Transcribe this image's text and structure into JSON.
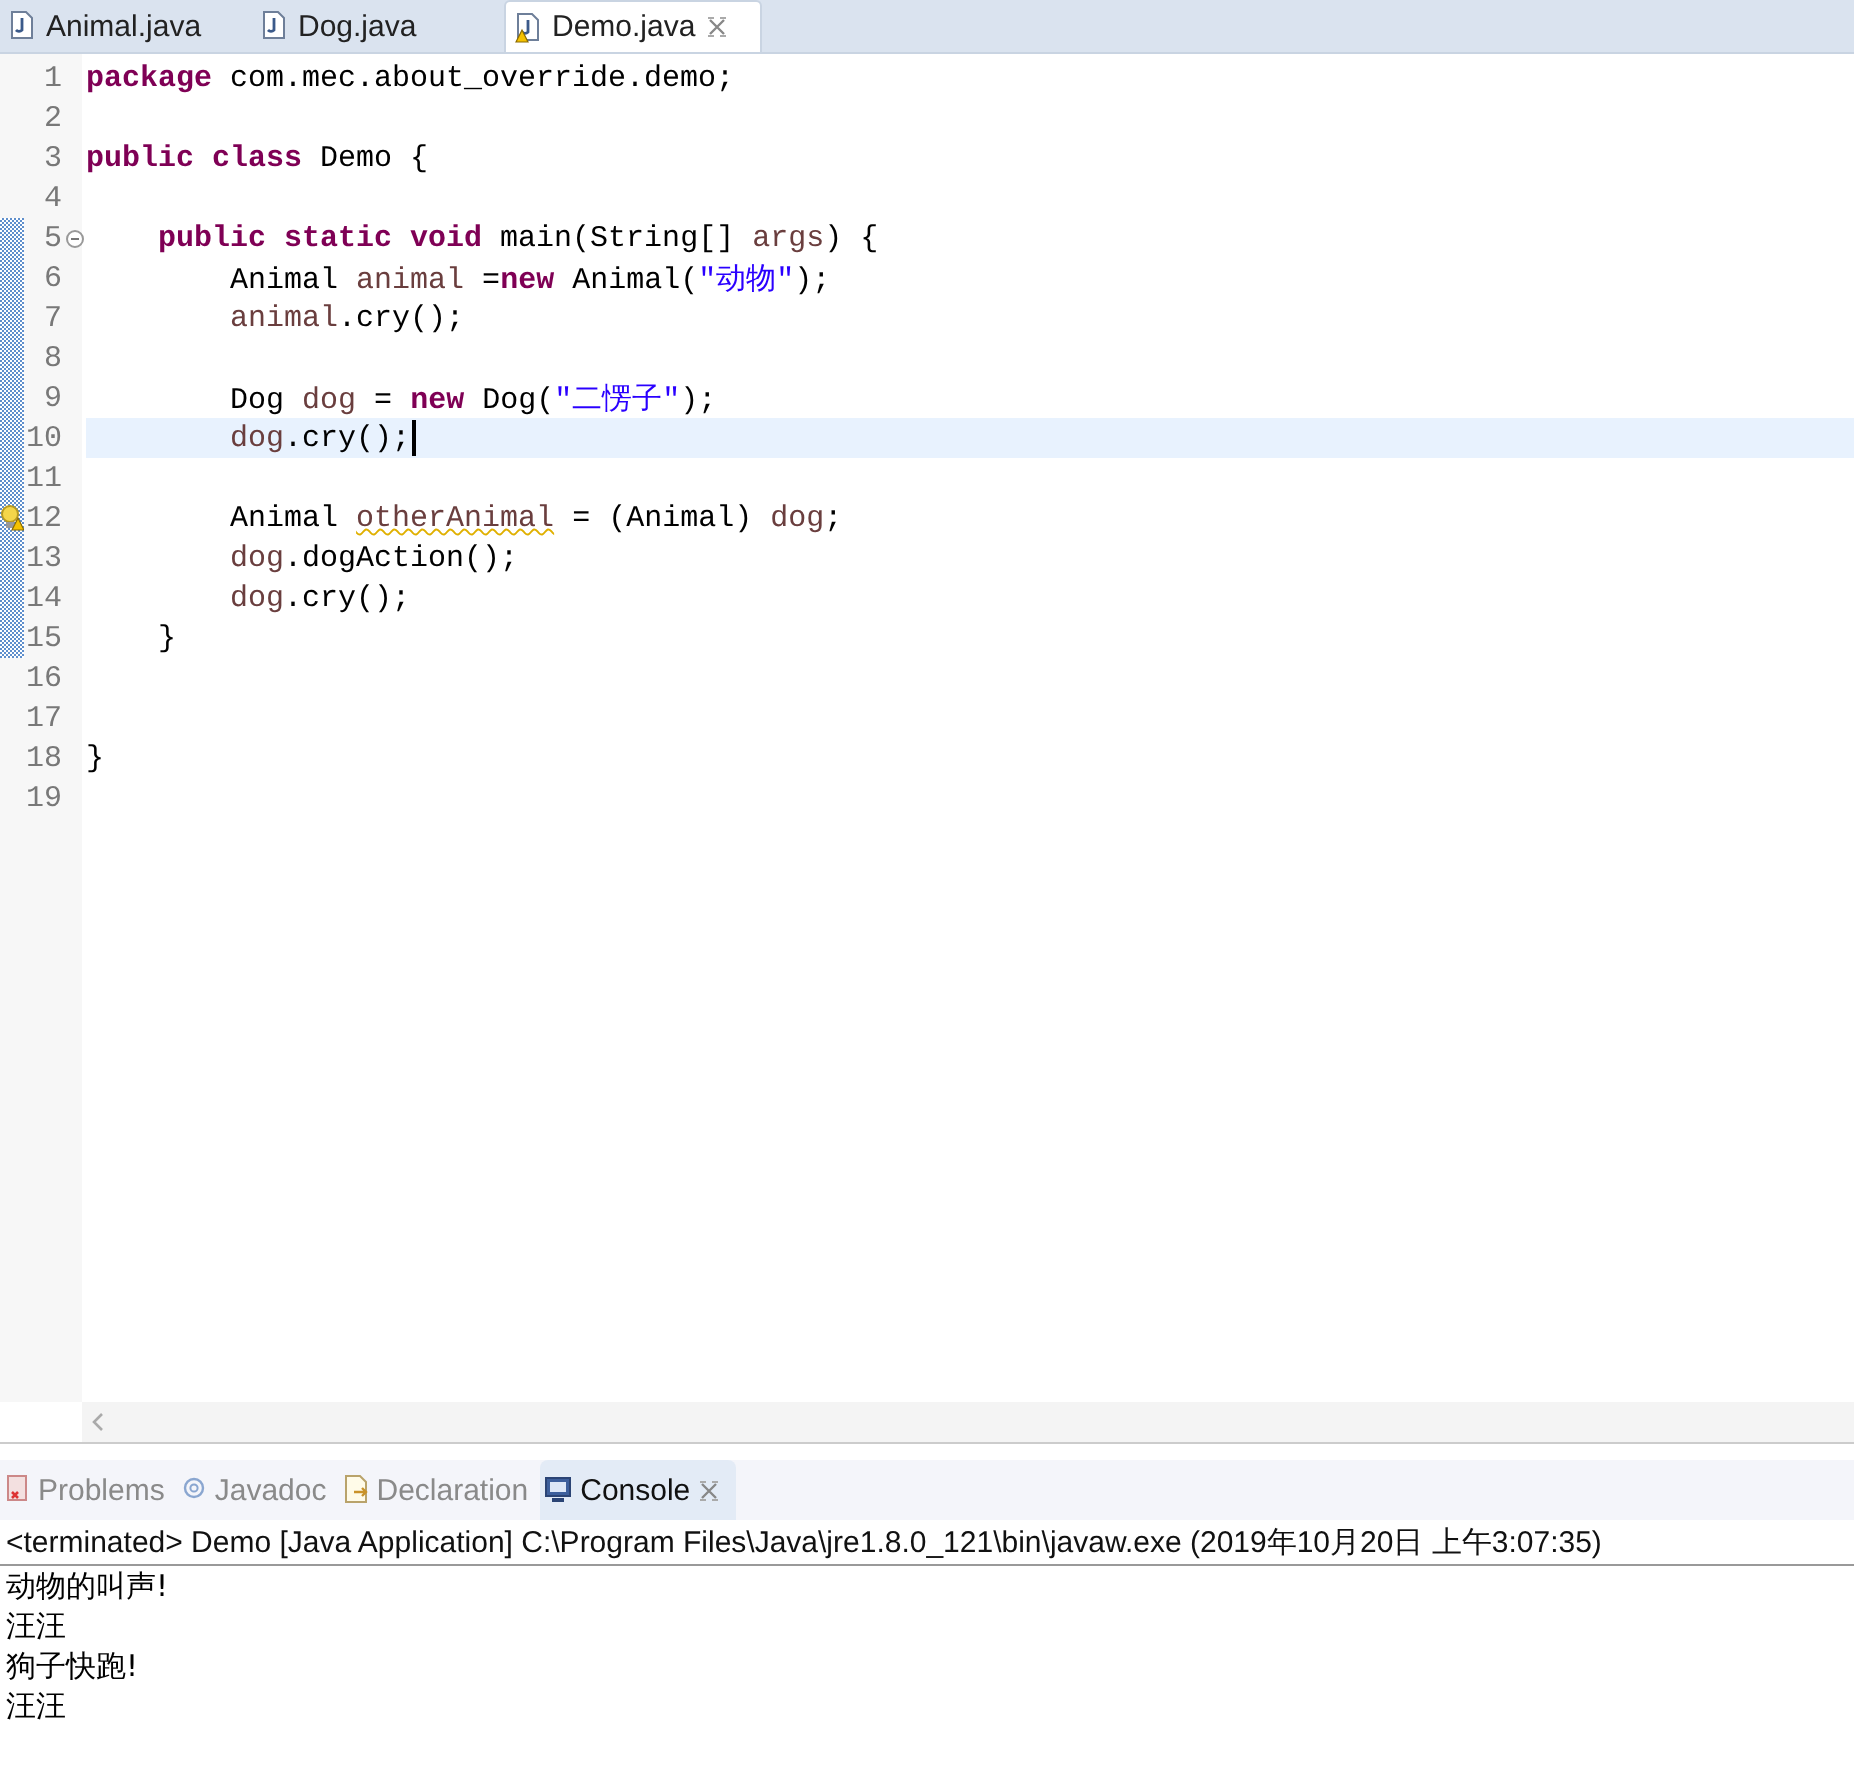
{
  "editor_tabs": [
    {
      "label": "Animal.java",
      "selected": false,
      "warning": false,
      "closable": false
    },
    {
      "label": "Dog.java",
      "selected": false,
      "warning": false,
      "closable": false
    },
    {
      "label": "Demo.java",
      "selected": true,
      "warning": true,
      "closable": true
    }
  ],
  "code_lines": [
    {
      "number": "1",
      "current": false,
      "in_range": false,
      "foldable": false,
      "warning": false,
      "tokens": [
        {
          "kind": "keyword",
          "text": "package"
        },
        {
          "kind": "plain",
          "text": " com.mec.about_override.demo;"
        }
      ]
    },
    {
      "number": "2",
      "current": false,
      "in_range": false,
      "foldable": false,
      "warning": false
    },
    {
      "number": "3",
      "current": false,
      "in_range": false,
      "foldable": false,
      "warning": false,
      "tokens": [
        {
          "kind": "keyword",
          "text": "public class"
        },
        {
          "kind": "plain",
          "text": " Demo {"
        }
      ]
    },
    {
      "number": "4",
      "current": false,
      "in_range": false,
      "foldable": false,
      "warning": false
    },
    {
      "number": "5",
      "current": false,
      "in_range": true,
      "foldable": true,
      "warning": false,
      "tokens": [
        {
          "kind": "keyword",
          "text": "    public static void"
        },
        {
          "kind": "plain",
          "text": " main(String[] "
        },
        {
          "kind": "variable",
          "text": "args"
        },
        {
          "kind": "plain",
          "text": ") {"
        }
      ]
    },
    {
      "number": "6",
      "current": false,
      "in_range": true,
      "foldable": false,
      "warning": false,
      "tokens": [
        {
          "kind": "plain",
          "text": "        Animal "
        },
        {
          "kind": "variable",
          "text": "animal"
        },
        {
          "kind": "plain",
          "text": " ="
        },
        {
          "kind": "keyword",
          "text": "new"
        },
        {
          "kind": "plain",
          "text": " Animal("
        },
        {
          "kind": "string",
          "text": "\"动物\""
        },
        {
          "kind": "plain",
          "text": ");"
        }
      ]
    },
    {
      "number": "7",
      "current": false,
      "in_range": true,
      "foldable": false,
      "warning": false,
      "tokens": [
        {
          "kind": "variable",
          "text": "        animal"
        },
        {
          "kind": "plain",
          "text": ".cry();"
        }
      ]
    },
    {
      "number": "8",
      "current": false,
      "in_range": true,
      "foldable": false,
      "warning": false
    },
    {
      "number": "9",
      "current": false,
      "in_range": true,
      "foldable": false,
      "warning": false,
      "tokens": [
        {
          "kind": "plain",
          "text": "        Dog "
        },
        {
          "kind": "variable",
          "text": "dog"
        },
        {
          "kind": "plain",
          "text": " = "
        },
        {
          "kind": "keyword",
          "text": "new"
        },
        {
          "kind": "plain",
          "text": " Dog("
        },
        {
          "kind": "string",
          "text": "\"二愣子\""
        },
        {
          "kind": "plain",
          "text": ");"
        }
      ]
    },
    {
      "number": "10",
      "current": true,
      "in_range": true,
      "foldable": false,
      "warning": false,
      "tokens": [
        {
          "kind": "variable",
          "text": "        dog"
        },
        {
          "kind": "plain",
          "text": ".cry();"
        }
      ]
    },
    {
      "number": "11",
      "current": false,
      "in_range": true,
      "foldable": false,
      "warning": false
    },
    {
      "number": "12",
      "current": false,
      "in_range": true,
      "foldable": false,
      "warning": true,
      "tokens": [
        {
          "kind": "plain",
          "text": "        Animal "
        },
        {
          "kind": "unused",
          "text": "otherAnimal"
        },
        {
          "kind": "plain",
          "text": " = (Animal) "
        },
        {
          "kind": "variable",
          "text": "dog"
        },
        {
          "kind": "plain",
          "text": ";"
        }
      ]
    },
    {
      "number": "13",
      "current": false,
      "in_range": true,
      "foldable": false,
      "warning": false,
      "tokens": [
        {
          "kind": "variable",
          "text": "        dog"
        },
        {
          "kind": "plain",
          "text": ".dogAction();"
        }
      ]
    },
    {
      "number": "14",
      "current": false,
      "in_range": true,
      "foldable": false,
      "warning": false,
      "tokens": [
        {
          "kind": "variable",
          "text": "        dog"
        },
        {
          "kind": "plain",
          "text": ".cry();"
        }
      ]
    },
    {
      "number": "15",
      "current": false,
      "in_range": true,
      "foldable": false,
      "warning": false,
      "tokens": [
        {
          "kind": "plain",
          "text": "    }"
        }
      ]
    },
    {
      "number": "16",
      "current": false,
      "in_range": false,
      "foldable": false,
      "warning": false
    },
    {
      "number": "17",
      "current": false,
      "in_range": false,
      "foldable": false,
      "warning": false
    },
    {
      "number": "18",
      "current": false,
      "in_range": false,
      "foldable": false,
      "warning": false,
      "tokens": [
        {
          "kind": "plain",
          "text": "}"
        }
      ]
    },
    {
      "number": "19",
      "current": false,
      "in_range": false,
      "foldable": false,
      "warning": false
    }
  ],
  "view_tabs": [
    {
      "label": "Problems",
      "selected": false,
      "closable": false
    },
    {
      "label": "Javadoc",
      "selected": false,
      "closable": false
    },
    {
      "label": "Declaration",
      "selected": false,
      "closable": false
    },
    {
      "label": "Console",
      "selected": true,
      "closable": true
    }
  ],
  "console": {
    "header": "<terminated> Demo [Java Application] C:\\Program Files\\Java\\jre1.8.0_121\\bin\\javaw.exe (2019年10月20日 上午3:07:35)",
    "output": [
      "动物的叫声!",
      "汪汪",
      "狗子快跑!",
      "汪汪"
    ]
  }
}
